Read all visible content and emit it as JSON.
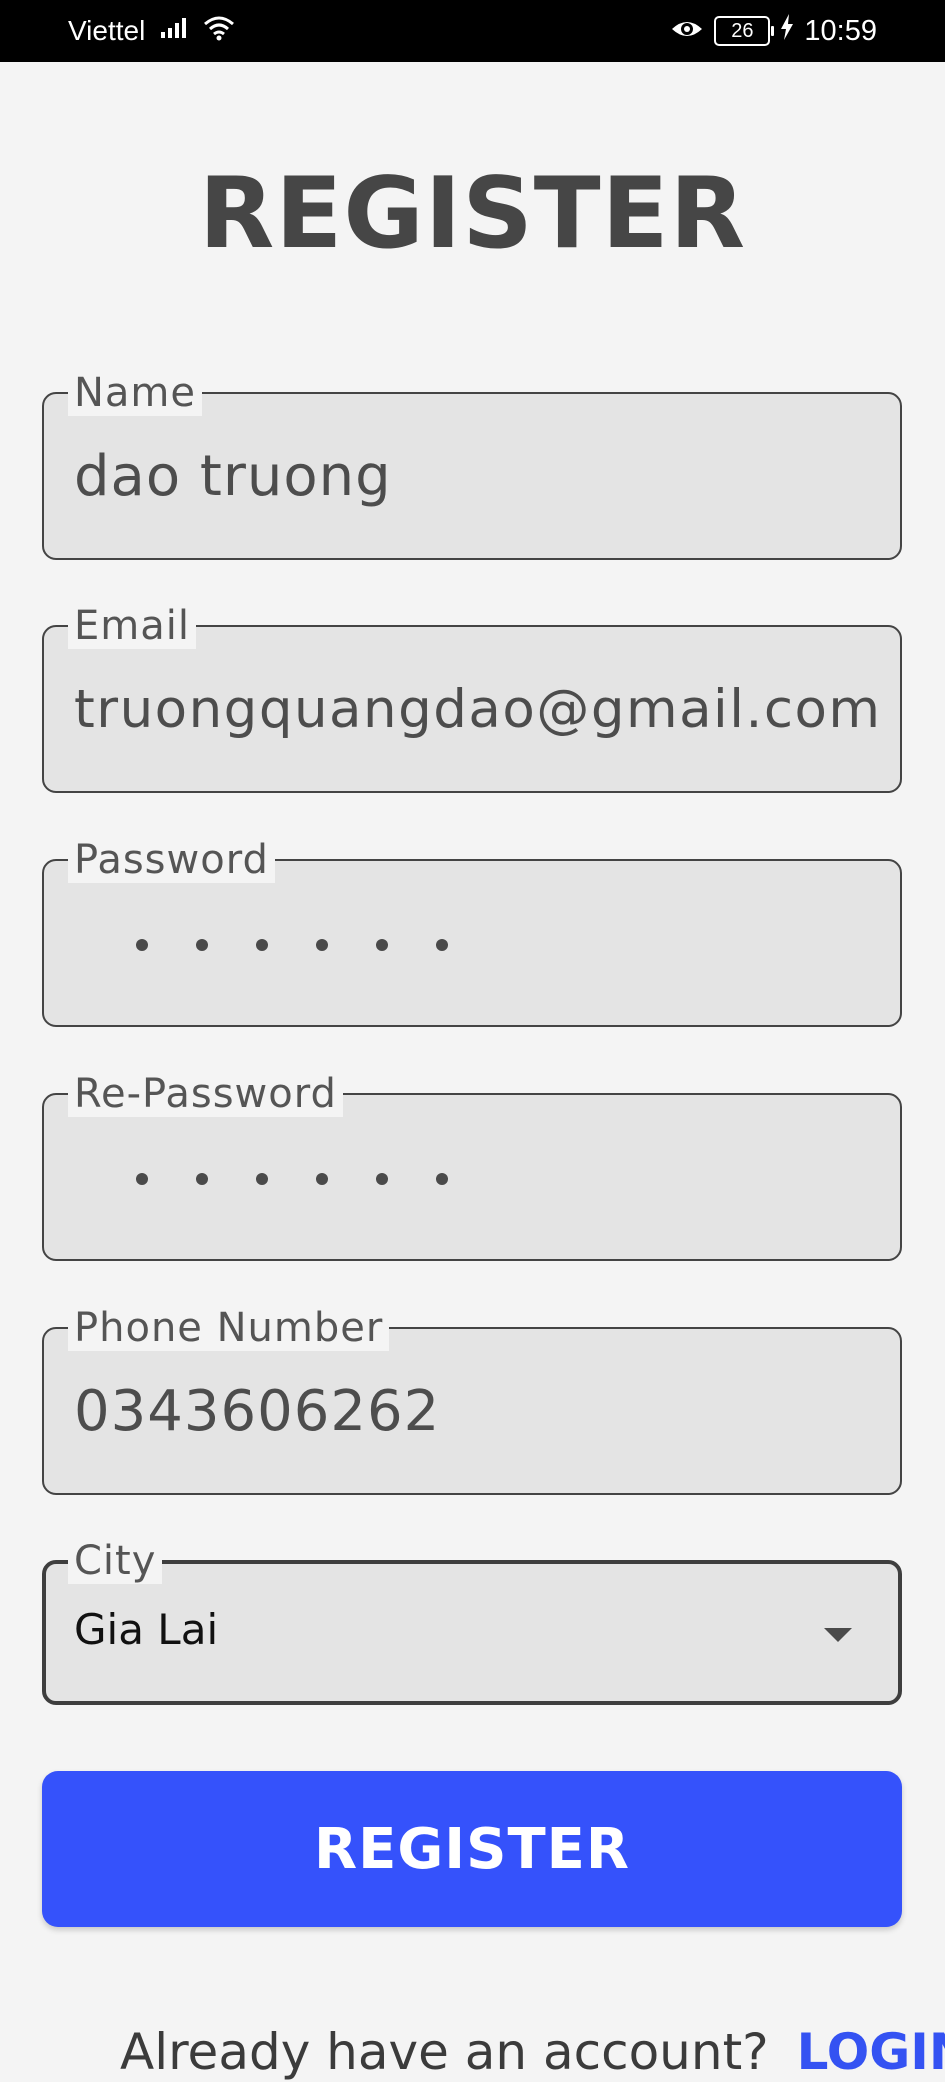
{
  "status_bar": {
    "carrier": "Viettel",
    "battery": "26",
    "time": "10:59"
  },
  "page": {
    "title": "REGISTER"
  },
  "form": {
    "name": {
      "label": "Name",
      "value": "dao truong"
    },
    "email": {
      "label": "Email",
      "value": "truongquangdao@gmail.com"
    },
    "password": {
      "label": "Password",
      "masked_length": 6
    },
    "re_password": {
      "label": "Re-Password",
      "masked_length": 6
    },
    "phone": {
      "label": "Phone Number",
      "value": "0343606262"
    },
    "city": {
      "label": "City",
      "selected": "Gia Lai"
    }
  },
  "register_button": {
    "label": "REGISTER"
  },
  "footer": {
    "prompt": "Already have an account?",
    "login_label": "LOGIN"
  },
  "colors": {
    "accent": "#3552fb",
    "field_bg": "#e4e4e4",
    "page_bg": "#f4f4f4"
  }
}
